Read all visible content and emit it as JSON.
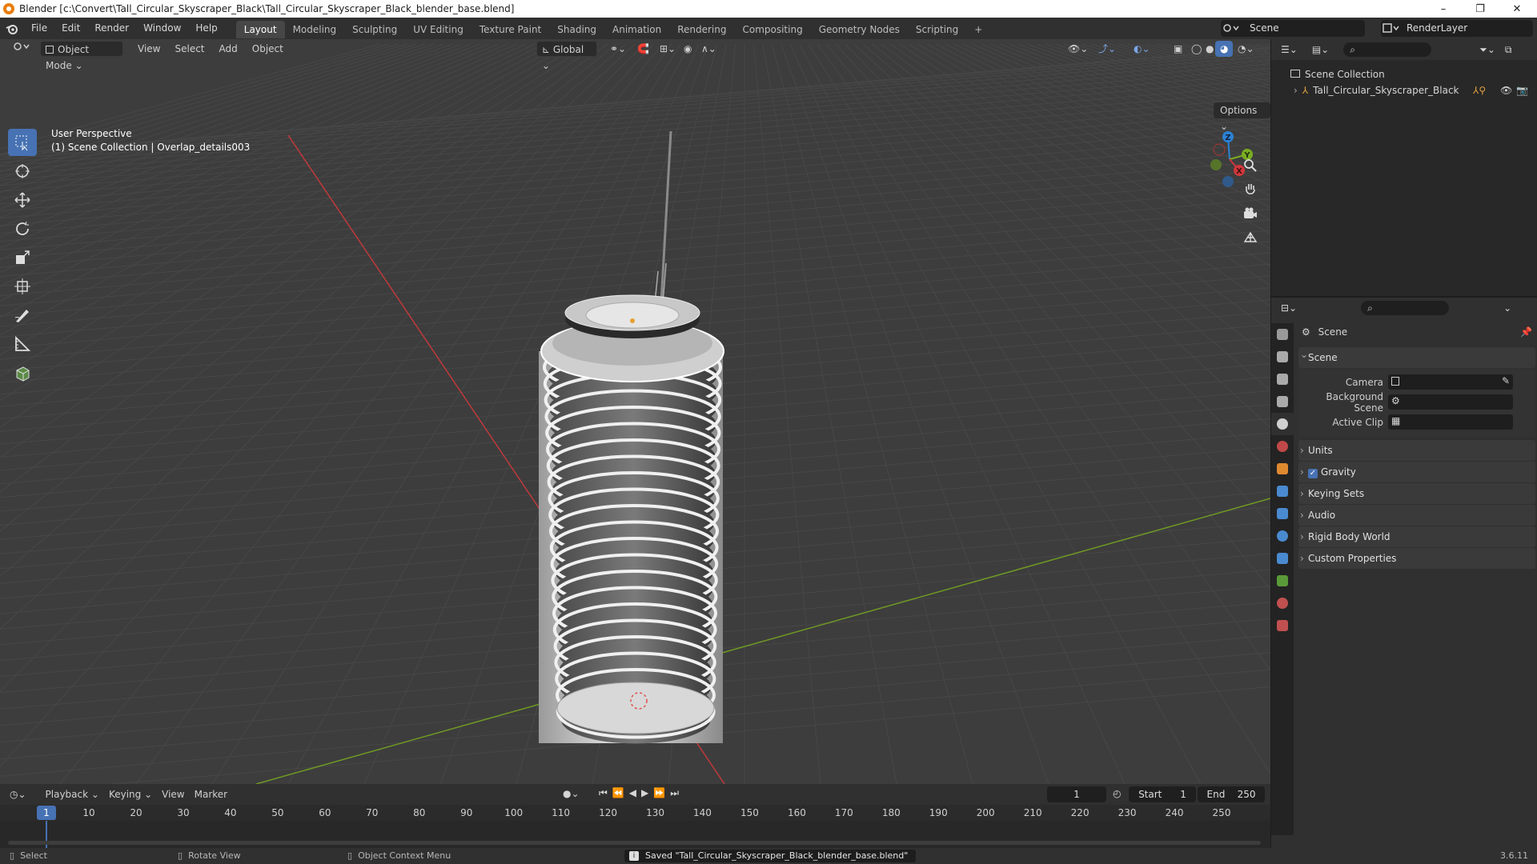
{
  "window": {
    "title": "Blender [c:\\Convert\\Tall_Circular_Skyscraper_Black\\Tall_Circular_Skyscraper_Black_blender_base.blend]",
    "controls": {
      "minimize": "–",
      "maximize": "❐",
      "close": "✕"
    }
  },
  "menu": [
    "File",
    "Edit",
    "Render",
    "Window",
    "Help"
  ],
  "workspaces": [
    "Layout",
    "Modeling",
    "Sculpting",
    "UV Editing",
    "Texture Paint",
    "Shading",
    "Animation",
    "Rendering",
    "Compositing",
    "Geometry Nodes",
    "Scripting"
  ],
  "workspace_add": "+",
  "scene_name": "Scene",
  "render_layer": "RenderLayer",
  "viewport": {
    "mode": "Object Mode",
    "menus": [
      "View",
      "Select",
      "Add",
      "Object"
    ],
    "orientation": "Global",
    "options_label": "Options",
    "perspective": "User Perspective",
    "collection_info": "(1) Scene Collection | Overlap_details003",
    "gizmo_axes": {
      "x": "X",
      "y": "Y",
      "z": "Z"
    }
  },
  "outliner": {
    "root": "Scene Collection",
    "items": [
      "Tall_Circular_Skyscraper_Black"
    ]
  },
  "properties": {
    "header": "Scene",
    "panel_scene": "Scene",
    "fields": [
      {
        "label": "Camera"
      },
      {
        "label": "Background Scene"
      },
      {
        "label": "Active Clip"
      }
    ],
    "panels": [
      "Units",
      "Gravity",
      "Keying Sets",
      "Audio",
      "Rigid Body World",
      "Custom Properties"
    ],
    "gravity_checked": true
  },
  "timeline": {
    "menus": [
      "Playback",
      "Keying",
      "View",
      "Marker"
    ],
    "current_frame": "1",
    "start_label": "Start",
    "start": "1",
    "end_label": "End",
    "end": "250",
    "ruler": [
      "1",
      "10",
      "20",
      "30",
      "40",
      "50",
      "60",
      "70",
      "80",
      "90",
      "100",
      "110",
      "120",
      "130",
      "140",
      "150",
      "160",
      "170",
      "180",
      "190",
      "200",
      "210",
      "220",
      "230",
      "240",
      "250"
    ]
  },
  "status": {
    "select": "Select",
    "rotate": "Rotate View",
    "context": "Object Context Menu",
    "message": "Saved \"Tall_Circular_Skyscraper_Black_blender_base.blend\"",
    "version": "3.6.11"
  },
  "colors": {
    "accent": "#4772b3",
    "x_axis": "#d0373b",
    "y_axis": "#7aad22",
    "z_axis": "#2c82d4",
    "brand": "#e87d0d"
  }
}
